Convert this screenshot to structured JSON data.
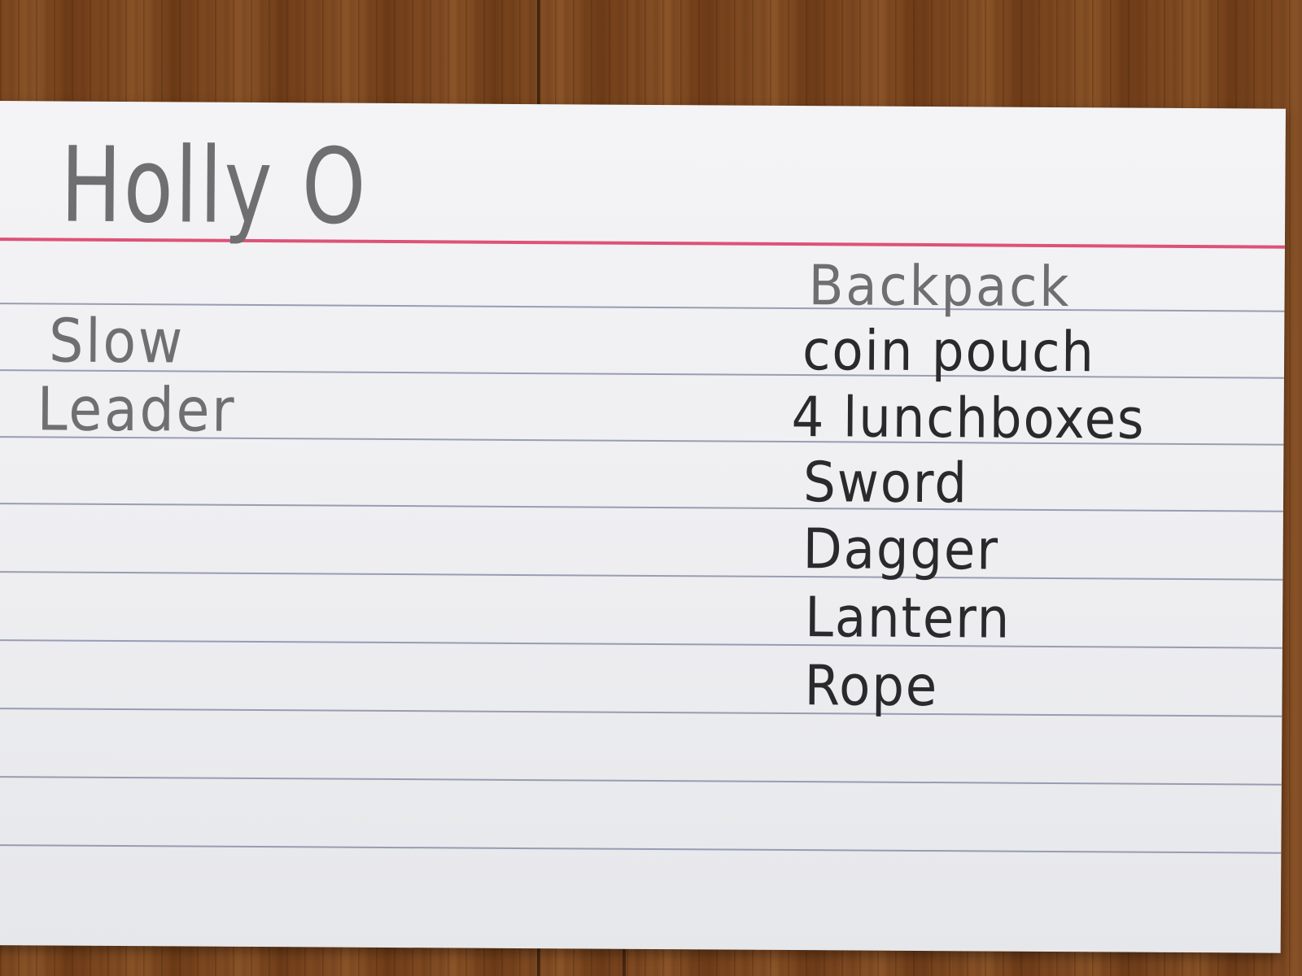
{
  "card": {
    "title": "Holly O",
    "traits": [
      "Slow",
      "Leader"
    ],
    "inventory": [
      "Backpack",
      "coin pouch",
      "4 lunchboxes",
      "Sword",
      "Dagger",
      "Lantern",
      "Rope"
    ]
  },
  "colors": {
    "card": "#f0f0f3",
    "red_rule": "#de5277",
    "blue_rule": "#8a8ea8",
    "pencil_light": "#6f6f72",
    "pencil_dark": "#2a2a2c",
    "wood": "#7a4620"
  }
}
